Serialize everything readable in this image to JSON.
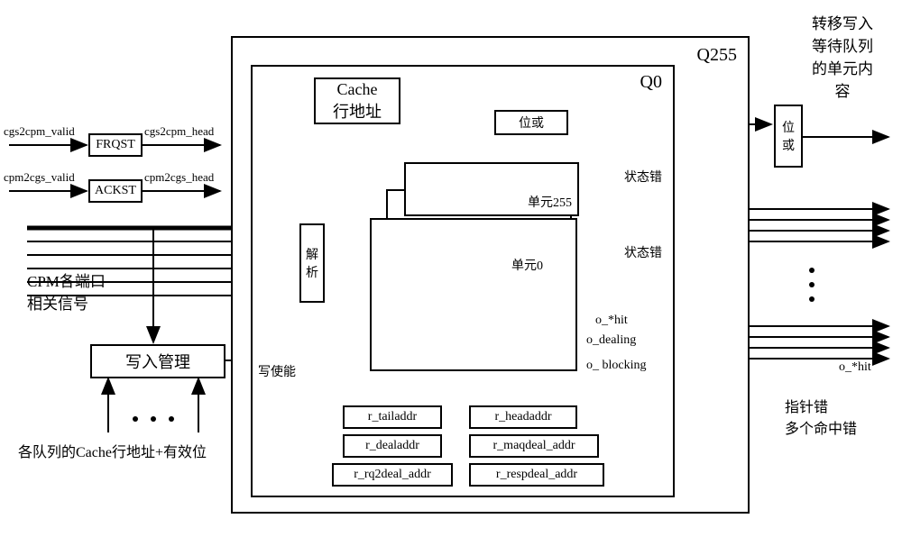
{
  "left": {
    "sig1_in": "cgs2cpm_valid",
    "sig1_out": "cgs2cpm_head",
    "sig2_in": "cpm2cgs_valid",
    "sig2_out": "cpm2cgs_head",
    "frqst": "FRQST",
    "ackst": "ACKST",
    "cpm_ports": "CPM各端口\n相关信号",
    "write_mgmt": "写入管理",
    "write_en": "写使能",
    "queue_addr": "各队列的Cache行地址+有效位"
  },
  "q": {
    "q255": "Q255",
    "q0": "Q0",
    "cache_line": "Cache\n行地址",
    "bit_or_inner": "位或",
    "parse": "解\n析",
    "unit255": "单元255",
    "unit0": "单元0",
    "state_err1": "状态错",
    "state_err2": "状态错",
    "o_hit": "o_*hit",
    "o_dealing": "o_dealing",
    "o_blocking": "o_ blocking",
    "r_tailaddr": "r_tailaddr",
    "r_dealaddr": "r_dealaddr",
    "r_rq2deal_addr": "r_rq2deal_addr",
    "r_headaddr": "r_headaddr",
    "r_maqdeal_addr": "r_maqdeal_addr",
    "r_respdeal_addr": "r_respdeal_addr"
  },
  "right": {
    "transfer": "转移写入\n等待队列\n的单元内\n容",
    "bit_or_outer": "位\n或",
    "o_hit_out": "o_*hit",
    "ptr_err": "指针错\n多个命中错"
  }
}
